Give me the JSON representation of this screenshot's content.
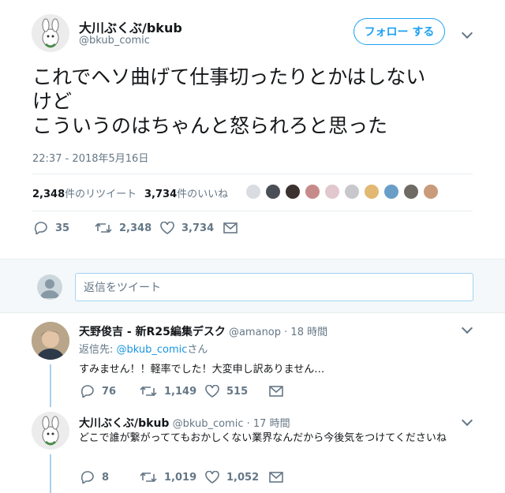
{
  "main": {
    "author_name": "大川ぶくぶ/bkub",
    "author_handle": "@bkub_comic",
    "follow_label": "フォロー する",
    "text_lines": [
      "これでヘソ曲げて仕事切ったりとかはしない",
      "けど",
      "こういうのはちゃんと怒られろと思った"
    ],
    "timestamp": "22:37 - 2018年5月16日",
    "retweets_count": "2,348",
    "retweets_label": "件のリツイート",
    "likes_count": "3,734",
    "likes_label": "件のいいね",
    "replies": "35",
    "retweets": "2,348",
    "likes": "3,734"
  },
  "reply_box": {
    "placeholder": "返信をツイート"
  },
  "replies": [
    {
      "name": "天野俊吉 - 新R25編集デスク",
      "handle": "@amanop",
      "time": "· 18 時間",
      "reply_to_prefix": "返信先: ",
      "reply_to_handle": "@bkub_comic",
      "reply_to_suffix": "さん",
      "text": "すみません！！軽率でした！大変申し訳ありません…",
      "replies": "76",
      "retweets": "1,149",
      "likes": "515"
    },
    {
      "name": "大川ぶくぶ/bkub",
      "handle": "@bkub_comic",
      "time": "· 17 時間",
      "text_line1": "どこで誰が繋がっててもおかしくない業界なんだから今後気をつけてくださいね",
      "replies": "8",
      "retweets": "1,019",
      "likes": "1,052"
    }
  ],
  "colors": {
    "accent": "#1da1f2",
    "muted": "#657786",
    "divider": "#e6ecf0",
    "thread": "#a6d0f0"
  }
}
